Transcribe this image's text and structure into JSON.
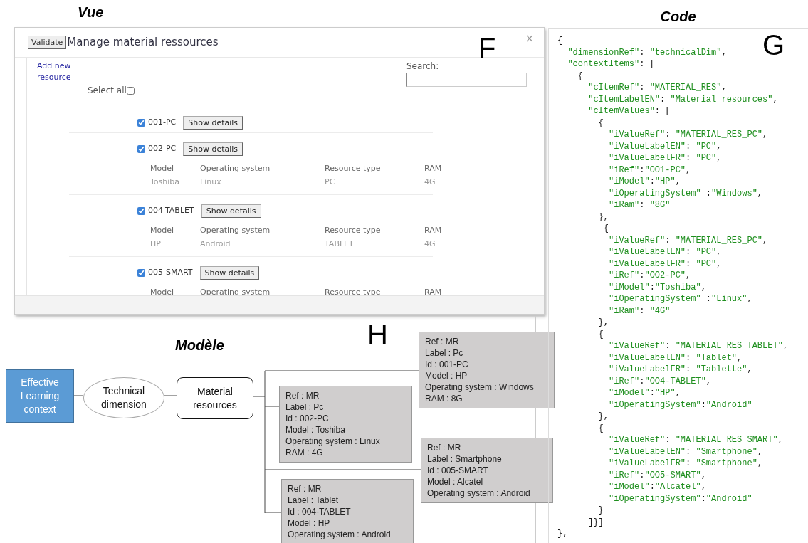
{
  "vue": {
    "title": "Vue",
    "marker": "F",
    "modal": {
      "validate_button": "Validate",
      "title": "Manage material ressources",
      "close": "×",
      "add_link": "Add new resource",
      "search": {
        "label": "Search:"
      },
      "select_all": {
        "label": "Select all",
        "checked": false
      },
      "resources": [
        {
          "id": "001-PC",
          "checked": true,
          "button": "Show details"
        },
        {
          "id": "002-PC",
          "checked": true,
          "button": "Show details",
          "columns": [
            "Model",
            "Operating system",
            "Resource type",
            "RAM"
          ],
          "values": [
            "Toshiba",
            "Linux",
            "PC",
            "4G"
          ]
        },
        {
          "id": "004-TABLET",
          "checked": true,
          "button": "Show details",
          "columns": [
            "Model",
            "Operating system",
            "Resource type",
            "RAM"
          ],
          "values": [
            "HP",
            "Android",
            "TABLET",
            "4G"
          ]
        },
        {
          "id": "005-SMART",
          "checked": true,
          "button": "Show details",
          "columns": [
            "Model",
            "Operating system",
            "Resource type",
            "RAM"
          ]
        }
      ]
    }
  },
  "code": {
    "title": "Code",
    "marker": "G",
    "lines": [
      "{",
      "  \"dimensionRef\": \"technicalDim\",",
      "  \"contextItems\": [",
      "    {",
      "      \"cItemRef\": \"MATERIAL_RES\",",
      "      \"cItemLabelEN\": \"Material resources\",",
      "      \"cItemValues\": [",
      "        {",
      "          \"iValueRef\": \"MATERIAL_RES_PC\",",
      "          \"iValueLabelEN\": \"PC\",",
      "          \"iValueLabelFR\": \"PC\",",
      "          \"iRef\":\"OO1-PC\",",
      "          \"iModel\":\"HP\",",
      "          \"iOperatingSystem\" :\"Windows\",",
      "          \"iRam\": \"8G\"",
      "        },",
      "         {",
      "          \"iValueRef\": \"MATERIAL_RES_PC\",",
      "          \"iValueLabelEN\": \"PC\",",
      "          \"iValueLabelFR\": \"PC\",",
      "          \"iRef\":\"OO2-PC\",",
      "          \"iModel\":\"Toshiba\",",
      "          \"iOperatingSystem\" :\"Linux\",",
      "          \"iRam\": \"4G\"",
      "        },",
      "        {",
      "          \"iValueRef\": \"MATERIAL_RES_TABLET\",",
      "          \"iValueLabelEN\": \"Tablet\",",
      "          \"iValueLabelFR\": \"Tablette\",",
      "          \"iRef\":\"OO4-TABLET\",",
      "          \"iModel\":\"HP\",",
      "          \"iOperatingSystem\":\"Android\"",
      "        },",
      "        {",
      "          \"iValueRef\": \"MATERIAL_RES_SMART\",",
      "          \"iValueLabelEN\": \"Smartphone\",",
      "          \"iValueLabelFR\": \"Smartphone\",",
      "          \"iRef\":\"OO5-SMART\",",
      "          \"iModel\":\"Alcatel\",",
      "          \"iOperatingSystem\":\"Android\"",
      "        }",
      "      ]}]",
      "},"
    ]
  },
  "model": {
    "title": "Modèle",
    "marker": "H",
    "nodes": [
      {
        "kind": "context",
        "text": "Effective Learning context"
      },
      {
        "kind": "dimension",
        "text": "Technical dimension"
      },
      {
        "kind": "item",
        "text": "Material resources"
      }
    ],
    "cards": [
      {
        "lines": [
          "Ref : MR",
          "Label : Pc",
          "Id : 001-PC",
          "Model : HP",
          "Operating system : Windows",
          "RAM : 8G"
        ]
      },
      {
        "lines": [
          "Ref : MR",
          "Label : Pc",
          "Id : 002-PC",
          "Model : Toshiba",
          "Operating system : Linux",
          "RAM : 4G"
        ]
      },
      {
        "lines": [
          "Ref : MR",
          "Label : Smartphone",
          "Id : 005-SMART",
          "Model : Alcatel",
          "Operating system : Android"
        ]
      },
      {
        "lines": [
          "Ref : MR",
          "Label : Tablet",
          "Id : 004-TABLET",
          "Model : HP",
          "Operating system : Android"
        ]
      }
    ]
  }
}
